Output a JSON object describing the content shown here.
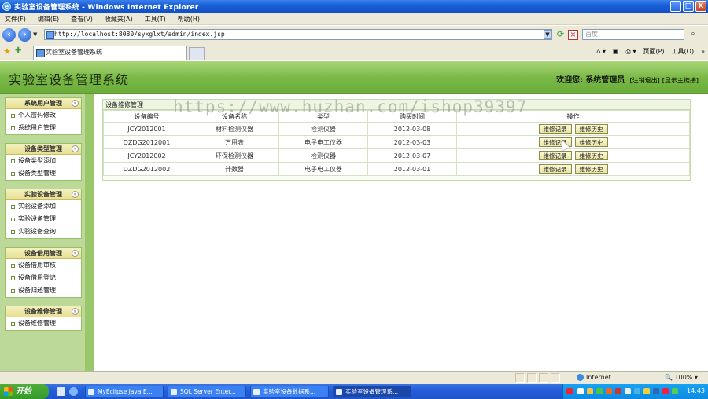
{
  "window": {
    "title": "实验室设备管理系统 - Windows Internet Explorer",
    "ie_logo": "e",
    "minimize": "_",
    "maximize": "□",
    "close": "X"
  },
  "menubar": [
    "文件(F)",
    "编辑(E)",
    "查看(V)",
    "收藏夹(A)",
    "工具(T)",
    "帮助(H)"
  ],
  "address": {
    "url": "http://localhost:8080/syxglxt/admin/index.jsp",
    "search_placeholder": "百度"
  },
  "tabs": [
    {
      "label": "实验室设备管理系统"
    }
  ],
  "commandbar": [
    "页面(P)",
    "工具(O)"
  ],
  "app": {
    "title": "实验室设备管理系统",
    "welcome_prefix": "欢迎您:",
    "user": "系统管理员",
    "logout_link": "[注销退出]",
    "home_link": "[显示主链接]"
  },
  "sidebar": {
    "groups": [
      {
        "title": "系统用户管理",
        "items": [
          "个人密码修改",
          "系统用户管理"
        ]
      },
      {
        "title": "设备类型管理",
        "items": [
          "设备类型添加",
          "设备类型管理"
        ]
      },
      {
        "title": "实验设备管理",
        "items": [
          "实验设备添加",
          "实验设备管理",
          "实验设备查询"
        ]
      },
      {
        "title": "设备借用管理",
        "items": [
          "设备借用审核",
          "设备借用登记",
          "设备归还管理"
        ]
      },
      {
        "title": "设备维修管理",
        "items": [
          "设备维修管理"
        ]
      }
    ]
  },
  "panel": {
    "title": "设备维修管理",
    "columns": [
      "设备编号",
      "设备名称",
      "类型",
      "购买时间",
      "操作"
    ],
    "rows": [
      {
        "code": "JCY2012001",
        "name": "材料检测仪器",
        "type": "检测仪器",
        "date": "2012-03-08"
      },
      {
        "code": "DZDG2012001",
        "name": "万用表",
        "type": "电子电工仪器",
        "date": "2012-03-03"
      },
      {
        "code": "JCY2012002",
        "name": "环保检测仪器",
        "type": "检测仪器",
        "date": "2012-03-07"
      },
      {
        "code": "DZDG2012002",
        "name": "计数器",
        "type": "电子电工仪器",
        "date": "2012-03-01"
      }
    ],
    "action_record": "维修记录",
    "action_history": "维修历史"
  },
  "watermark": "https://www.huzhan.com/ishop39397",
  "statusbar": {
    "zone": "Internet",
    "zoom": "100%"
  },
  "taskbar": {
    "start": "开始",
    "tasks": [
      "MyEclipse Java E...",
      "SQL Server Enter...",
      "实验室设备数据系...",
      "实验室设备管理系..."
    ],
    "clock": "14:43"
  }
}
